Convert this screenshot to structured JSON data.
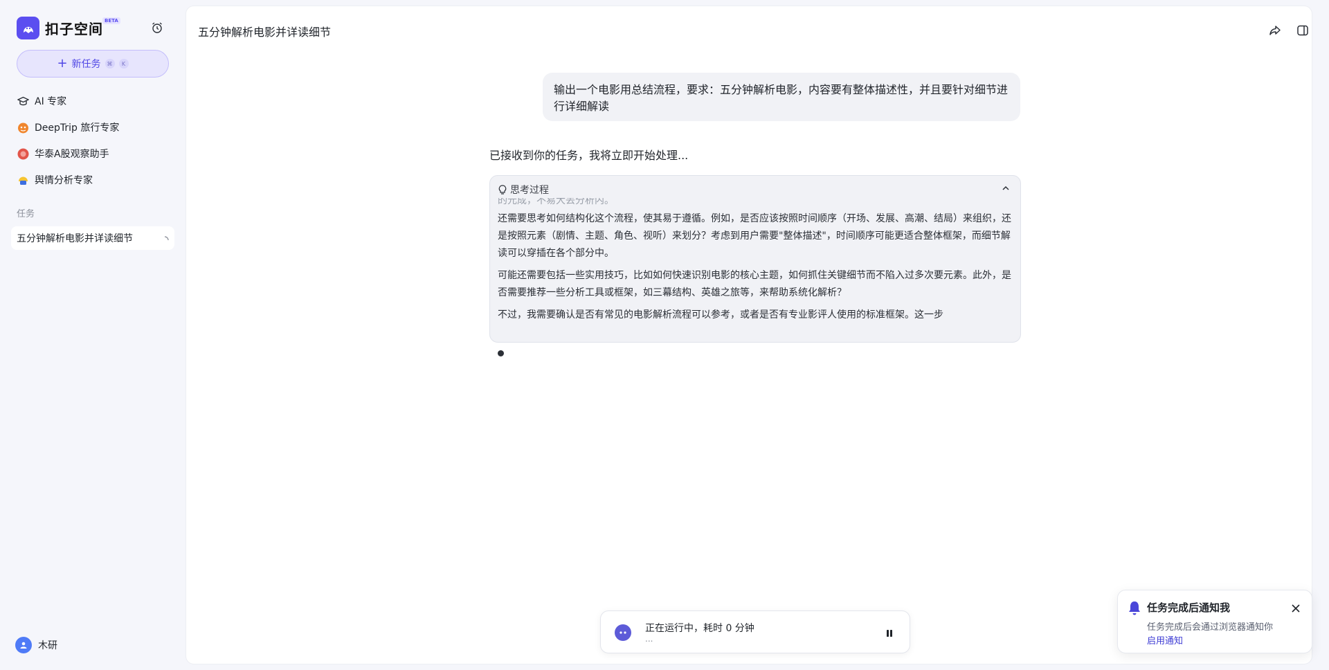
{
  "sidebar": {
    "brand": {
      "name": "扣子空间",
      "badge": "BETA",
      "logo_color": "#5b4ef0"
    },
    "new_task": {
      "label": "新任务",
      "shortcut_1": "⌘",
      "shortcut_2": "K"
    },
    "experts": [
      {
        "label": "AI 专家",
        "icon": "graduation-cap-icon"
      },
      {
        "label": "DeepTrip 旅行专家",
        "icon": "deeptrip-icon"
      },
      {
        "label": "华泰A股观察助手",
        "icon": "huatai-icon"
      },
      {
        "label": "舆情分析专家",
        "icon": "sentiment-icon"
      }
    ],
    "section_title": "任务",
    "tasks": [
      {
        "label": "五分钟解析电影并详读细节",
        "state": "running"
      }
    ],
    "user": {
      "name": "木研"
    }
  },
  "main": {
    "title": "五分钟解析电影并详读细节",
    "user_message": "输出一个电影用总结流程，要求：五分钟解析电影，内容要有整体描述性，并且要针对细节进行详细解读",
    "ack": "已接收到你的任务，我将立即开始处理...",
    "thinking": {
      "title": "思考过程",
      "clipped_line": "的元成，不易大丢分析内。",
      "paragraphs": [
        "还需要思考如何结构化这个流程，使其易于遵循。例如，是否应该按照时间顺序（开场、发展、高潮、结局）来组织，还是按照元素（剧情、主题、角色、视听）来划分？考虑到用户需要\"整体描述\"，时间顺序可能更适合整体框架，而细节解读可以穿插在各个部分中。",
        "可能还需要包括一些实用技巧，比如如何快速识别电影的核心主题，如何抓住关键细节而不陷入过多次要元素。此外，是否需要推荐一些分析工具或框架，如三幕结构、英雄之旅等，来帮助系统化解析？",
        "不过，我需要确认是否有常见的电影解析流程可以参考，或者是否有专业影评人使用的标准框架。这一步"
      ]
    },
    "status": {
      "text": "正在运行中，耗时 0 分钟",
      "sub": "...",
      "accent": "#5d5bd8"
    },
    "toast": {
      "title": "任务完成后通知我",
      "desc": "任务完成后会通过浏览器通知你",
      "link": "启用通知",
      "accent": "#3d3bd4"
    }
  }
}
